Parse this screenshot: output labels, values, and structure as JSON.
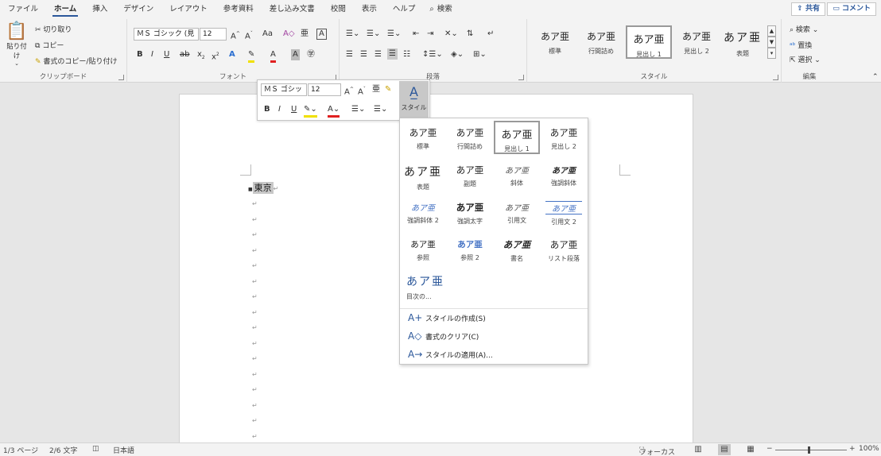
{
  "tabs": [
    "ファイル",
    "ホーム",
    "挿入",
    "デザイン",
    "レイアウト",
    "参考資料",
    "差し込み文書",
    "校閲",
    "表示",
    "ヘルプ"
  ],
  "tab_search": "検索",
  "share": "共有",
  "comment": "コメント",
  "clipboard": {
    "paste": "貼り付け",
    "cut": "切り取り",
    "copy": "コピー",
    "format_painter": "書式のコピー/貼り付け",
    "label": "クリップボード"
  },
  "font": {
    "name": "ＭＳ ゴシック (見",
    "size": "12",
    "label": "フォント"
  },
  "paragraph": {
    "label": "段落"
  },
  "styles": {
    "items": [
      {
        "preview": "あア亜",
        "name": "標準"
      },
      {
        "preview": "あア亜",
        "name": "行間詰め"
      },
      {
        "preview": "あア亜",
        "name": "見出し 1"
      },
      {
        "preview": "あア亜",
        "name": "見出し 2"
      },
      {
        "preview": "あア亜",
        "name": "表題"
      }
    ],
    "label": "スタイル"
  },
  "editing": {
    "find": "検索",
    "replace": "置換",
    "select": "選択",
    "label": "編集"
  },
  "mini_toolbar": {
    "font": "ＭＳ ゴシッ",
    "size": "12",
    "style_label": "スタイル"
  },
  "document": {
    "first_line": "東京"
  },
  "style_gallery": {
    "cells": [
      {
        "preview": "あア亜",
        "name": "標準"
      },
      {
        "preview": "あア亜",
        "name": "行間詰め"
      },
      {
        "preview": "あア亜",
        "name": "見出し 1"
      },
      {
        "preview": "あア亜",
        "name": "見出し 2"
      },
      {
        "preview": "あア亜",
        "name": "表題"
      },
      {
        "preview": "あア亜",
        "name": "副題"
      },
      {
        "preview": "あア亜",
        "name": "斜体"
      },
      {
        "preview": "あア亜",
        "name": "強調斜体"
      },
      {
        "preview": "あア亜",
        "name": "強調斜体 2"
      },
      {
        "preview": "あア亜",
        "name": "強調太字"
      },
      {
        "preview": "あア亜",
        "name": "引用文"
      },
      {
        "preview": "あア亜",
        "name": "引用文 2"
      },
      {
        "preview": "あア亜",
        "name": "参照"
      },
      {
        "preview": "あア亜",
        "name": "参照 2"
      },
      {
        "preview": "あア亜",
        "name": "書名"
      },
      {
        "preview": "あア亜",
        "name": "リスト段落"
      },
      {
        "preview": "あア亜",
        "name": "目次の..."
      }
    ],
    "commands": [
      {
        "label": "スタイルの作成(S)",
        "icon": "A+"
      },
      {
        "label": "書式のクリア(C)",
        "icon": "A◇"
      },
      {
        "label": "スタイルの適用(A)...",
        "icon": "A→"
      }
    ]
  },
  "status": {
    "page": "1/3 ページ",
    "words": "2/6 文字",
    "language": "日本語",
    "focus": "フォーカス",
    "zoom": "100%"
  }
}
